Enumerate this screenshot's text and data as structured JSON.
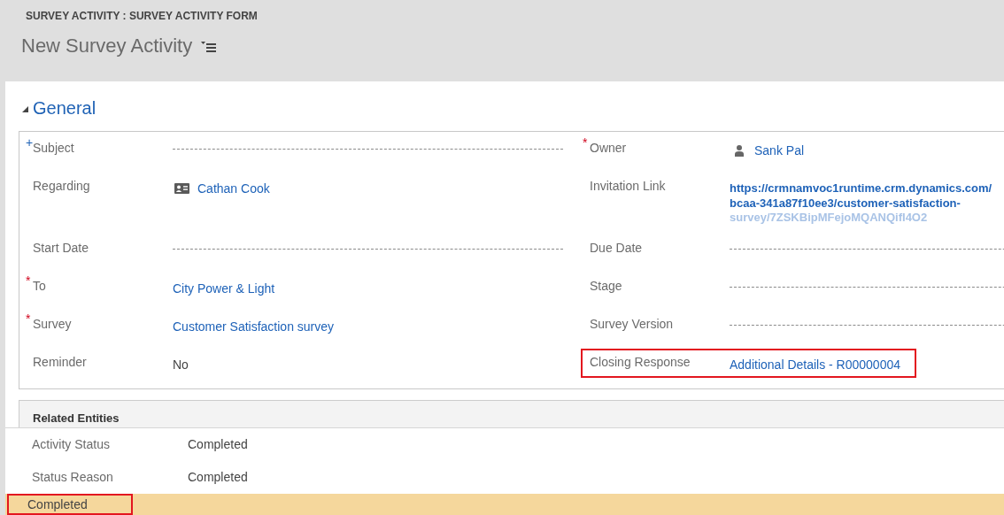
{
  "header": {
    "breadcrumb": "SURVEY ACTIVITY : SURVEY ACTIVITY FORM",
    "title": "New Survey Activity"
  },
  "section": {
    "title": "General",
    "expanded": true,
    "rows": [
      {
        "left": {
          "label": "Subject",
          "requirement": {
            "symbol": "+",
            "kind": "recommended"
          },
          "kind": "empty",
          "highlighted": false
        },
        "right": {
          "label": "Owner",
          "requirement": {
            "symbol": "*",
            "kind": "required"
          },
          "kind": "user-link",
          "value": "Sank Pal",
          "highlighted": false
        }
      },
      {
        "left": {
          "label": "Regarding",
          "kind": "contact-link",
          "value": "Cathan Cook",
          "highlighted": false
        },
        "right": {
          "label": "Invitation Link",
          "kind": "url",
          "lines": [
            {
              "text": "https://crmnamvoc1runtime.crm.dynamics.com/",
              "faded": false
            },
            {
              "text": "bcaa-341a87f10ee3/customer-satisfaction-",
              "faded": false
            },
            {
              "text": "survey/7ZSKBipMFejoMQANQifI4O2",
              "faded": true
            }
          ],
          "highlighted": false
        }
      },
      {
        "left": {
          "label": "Start Date",
          "kind": "empty",
          "highlighted": false
        },
        "right": {
          "label": "Due Date",
          "kind": "empty",
          "highlighted": false
        }
      },
      {
        "left": {
          "label": "To",
          "requirement": {
            "symbol": "*",
            "kind": "required"
          },
          "kind": "link",
          "value": "City Power & Light",
          "highlighted": false
        },
        "right": {
          "label": "Stage",
          "kind": "empty",
          "highlighted": false
        }
      },
      {
        "left": {
          "label": "Survey",
          "requirement": {
            "symbol": "*",
            "kind": "required"
          },
          "kind": "link",
          "value": "Customer Satisfaction survey",
          "highlighted": false
        },
        "right": {
          "label": "Survey Version",
          "kind": "empty",
          "highlighted": false
        }
      },
      {
        "left": {
          "label": "Reminder",
          "kind": "text",
          "value": "No",
          "highlighted": false
        },
        "right": {
          "label": "Closing Response",
          "kind": "link",
          "value": "Additional Details - R00000004",
          "highlighted": true
        }
      }
    ]
  },
  "related_entities": {
    "title": "Related Entities",
    "fields": [
      {
        "label": "Activity Status",
        "value": "Completed"
      },
      {
        "label": "Status Reason",
        "value": "Completed"
      }
    ]
  },
  "status_bar": {
    "text": "Completed",
    "highlighted": true
  }
}
